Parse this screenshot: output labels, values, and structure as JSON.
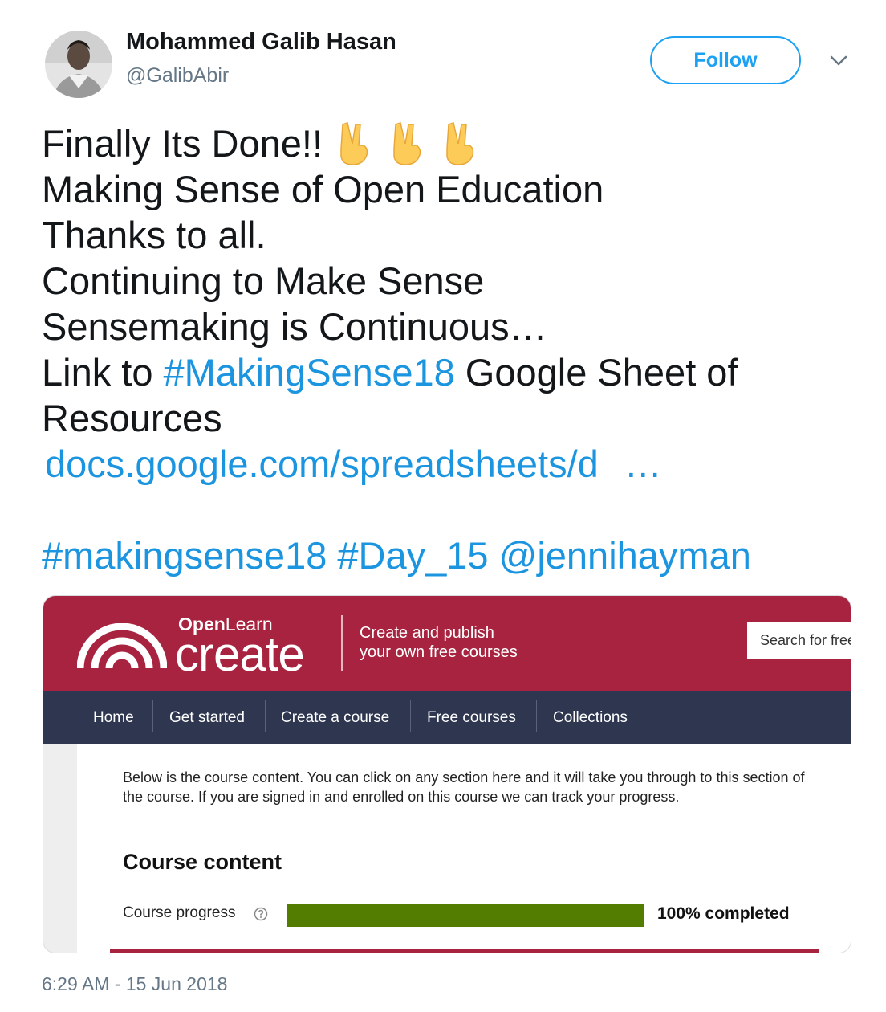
{
  "author": {
    "name": "Mohammed Galib Hasan",
    "handle": "@GalibAbir",
    "avatar_icon": "profile-photo"
  },
  "follow_button": {
    "label": "Follow",
    "color": "#1da1f2"
  },
  "more_menu": {
    "icon": "chevron-down-icon"
  },
  "tweet": {
    "line1": "Finally Its Done!! ",
    "line1_emoji": "victory-hand-icon",
    "line2": "Making Sense of Open Education",
    "line3": "Thanks to all.",
    "line4": "Continuing to Make Sense",
    "line5": "Sensemaking is Continuous…",
    "line6_prefix": "Link to ",
    "line6_hashtag": "#MakingSense18",
    "line6_suffix": " Google Sheet of",
    "line7": "Resources",
    "link": "docs.google.com/spreadsheets/d",
    "link_ellipsis": "…",
    "hashtag1": "#makingsense18",
    "hashtag2": "#Day_15",
    "mention": "@jennihayman",
    "link_color": "#1b95e0"
  },
  "card": {
    "brand_top_bold": "Open",
    "brand_top_rest": "Learn",
    "brand_main": "create",
    "tagline_line1": "Create and publish",
    "tagline_line2": "your own free courses",
    "search_placeholder": "Search for free",
    "header_color": "#a8233f",
    "nav_color": "#2e3650",
    "nav": [
      "Home",
      "Get started",
      "Create a course",
      "Free courses",
      "Collections"
    ],
    "intro": "Below is the course content. You can click on any section here and it will take you through to this section of the course. If you are signed in and enrolled on this course we can track your progress.",
    "heading": "Course content",
    "progress_label": "Course progress",
    "help_icon": "question-circle-icon",
    "progress_fraction": 1.0,
    "progress_color": "#527d00",
    "progress_text": "100% completed"
  },
  "timestamp": "6:29 AM - 15 Jun 2018"
}
